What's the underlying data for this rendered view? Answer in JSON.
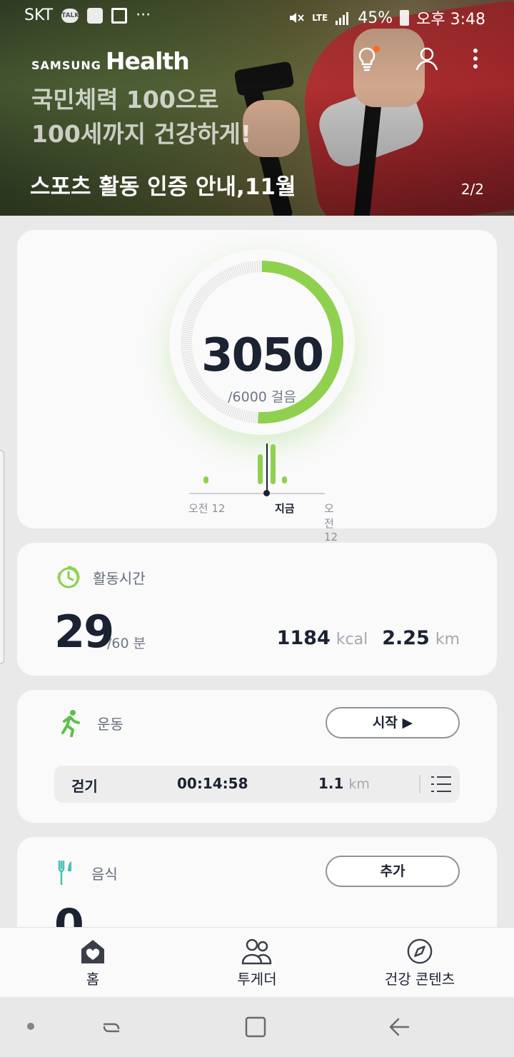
{
  "status_bar": {
    "carrier": "SKT",
    "talk_badge": "TALK",
    "more": "···",
    "network": "LTE",
    "battery": "45%",
    "time": "오후 3:48"
  },
  "banner": {
    "brand_small": "SAMSUNG",
    "brand_large": "Health",
    "subtitle": "국민체력 100으로\n100세까지 건강하게!",
    "title": "스포츠 활동 인증 안내,11월",
    "page_indicator": "2/2"
  },
  "steps": {
    "value": "3050",
    "goal_text": "/6000 걸음",
    "progress": 0.508,
    "timeline_labels": {
      "start": "오전 12",
      "now": "지금",
      "end": "오전 12"
    },
    "colors": {
      "accent": "#8fd14f",
      "track": "#e3e3e3"
    }
  },
  "activity": {
    "title": "활동시간",
    "value": "29",
    "goal_text": "/60 분",
    "kcal_value": "1184",
    "kcal_unit": "kcal",
    "distance_value": "2.25",
    "distance_unit": "km"
  },
  "exercise": {
    "title": "운동",
    "start_button": "시작 ▶",
    "record": {
      "type": "걷기",
      "duration": "00:14:58",
      "distance": "1.1",
      "distance_unit": "km"
    }
  },
  "food": {
    "title": "음식",
    "add_button": "추가",
    "value": "0"
  },
  "bottom_nav": {
    "home": "홈",
    "together": "투게더",
    "contents": "건강 콘텐츠"
  }
}
